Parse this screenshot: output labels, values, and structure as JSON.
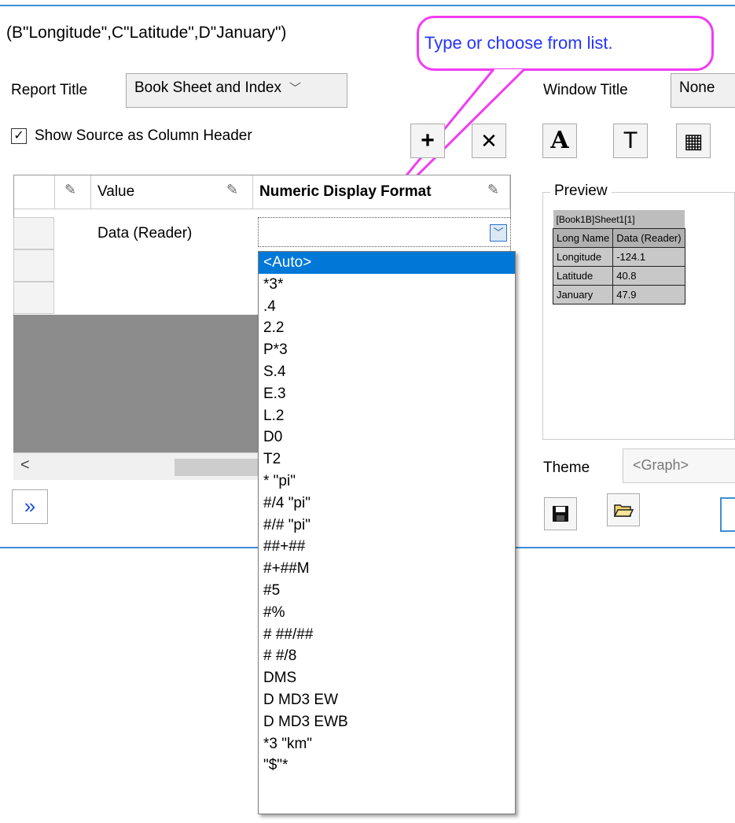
{
  "source_text": "(B\"Longitude\",C\"Latitude\",D\"January\")",
  "callout": "Type or choose from list.",
  "report_title": {
    "label": "Report Title",
    "value": "Book Sheet and Index"
  },
  "window_title": {
    "label": "Window Title",
    "value": "None"
  },
  "show_source": {
    "label": "Show Source as Column Header",
    "checked": true
  },
  "toolbar": {
    "add": "+",
    "delete": "✕",
    "font_a": "A",
    "text_t": "T",
    "table": "▦"
  },
  "grid": {
    "headers": [
      "Value",
      "Numeric Display Format"
    ],
    "row1_value": "Data (Reader)"
  },
  "scroll_left": "<",
  "more_button": "»",
  "dropdown_items": [
    "<Auto>",
    "*3*",
    ".4",
    "2.2",
    "P*3",
    "S.4",
    "E.3",
    "L.2",
    "D0",
    "T2",
    "* \"pi\"",
    "#/4 \"pi\"",
    "#/# \"pi\"",
    "##+##",
    "#+##M",
    "#5",
    "#%",
    "# ##/##",
    "# #/8",
    "DMS",
    "D MD3 EW",
    "D MD3 EWB",
    "*3 \"km\"",
    "\"$\"*"
  ],
  "preview": {
    "label": "Preview",
    "caption": "[Book1B]Sheet1[1]",
    "head": [
      "Long Name",
      "Data (Reader)"
    ],
    "rows": [
      [
        "Longitude",
        "-124.1"
      ],
      [
        "Latitude",
        "40.8"
      ],
      [
        "January",
        "47.9"
      ]
    ]
  },
  "theme": {
    "label": "Theme",
    "value": "<Graph>"
  },
  "colors": {
    "accent": "#3c8fd6",
    "callout_border": "#f23cf2",
    "callout_text": "#2433ff",
    "selection": "#0078d7"
  }
}
